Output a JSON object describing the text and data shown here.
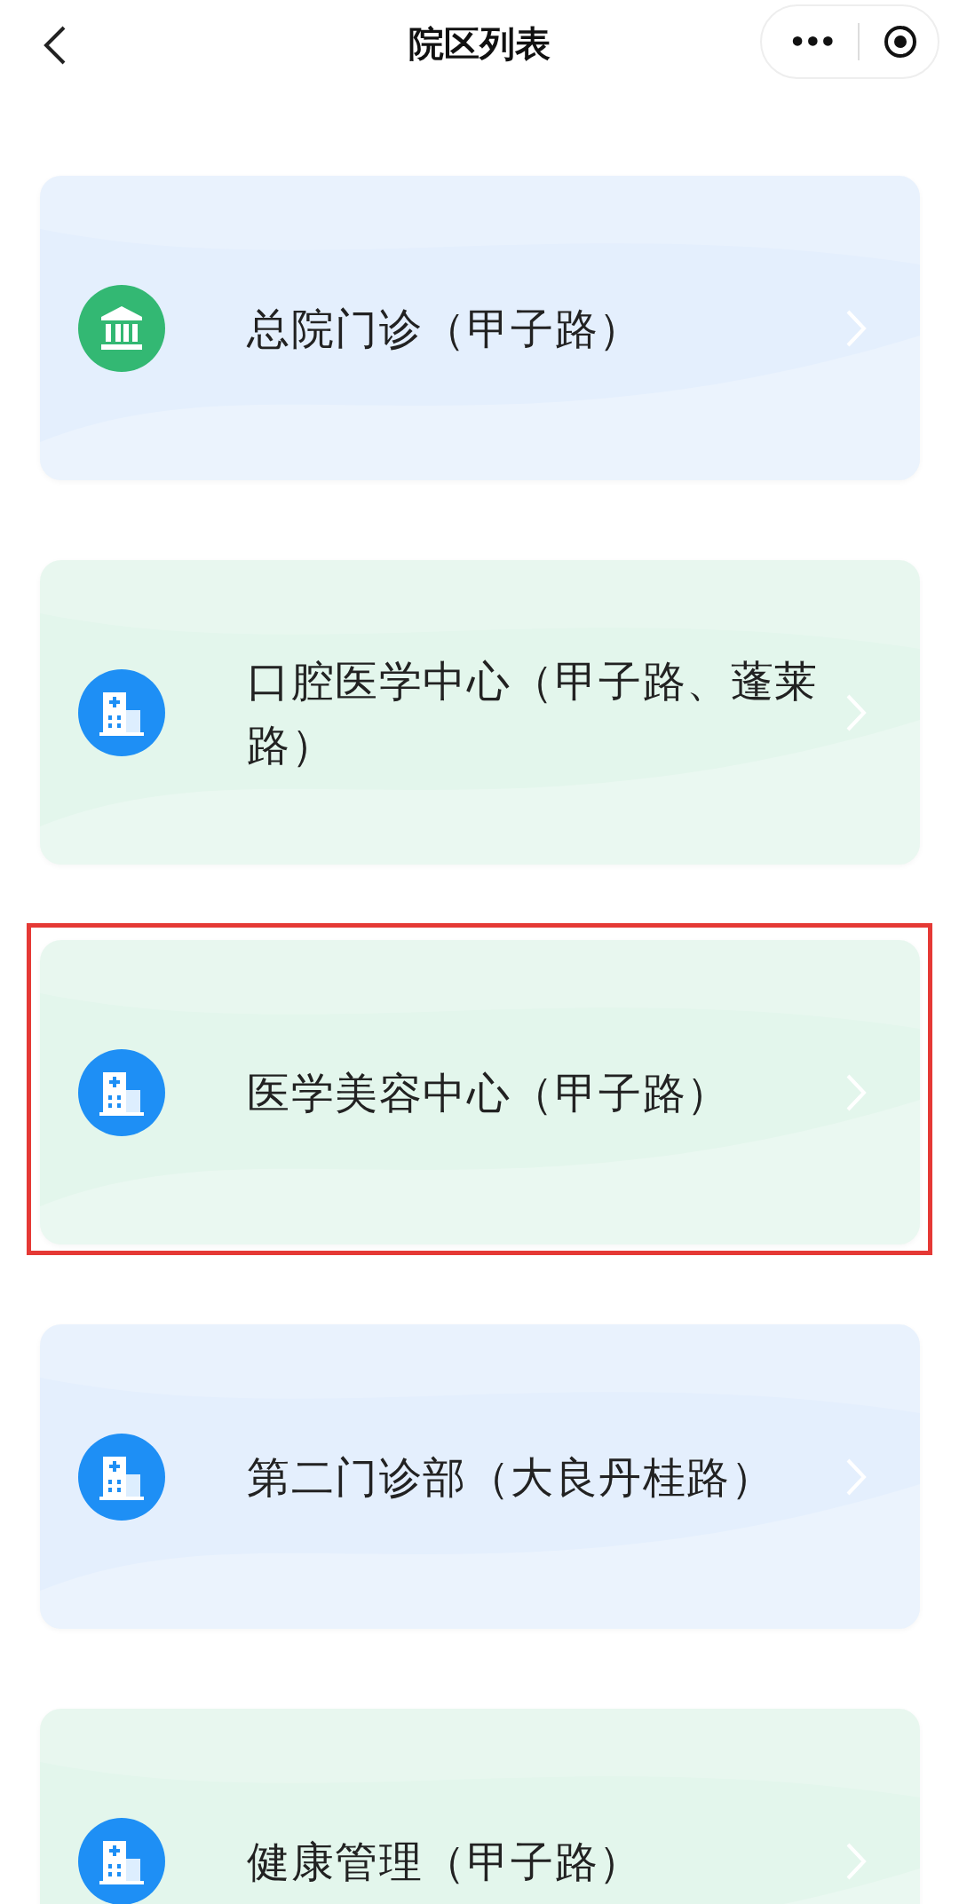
{
  "nav": {
    "title": "院区列表",
    "menu": "•••"
  },
  "campuses": [
    {
      "name": "总院门诊（甲子路）",
      "color": "#e4effd",
      "kind": "bank",
      "highlighted": false
    },
    {
      "name": "口腔医学中心（甲子路、蓬莱路）",
      "color": "#e3f6ec",
      "kind": "hospital",
      "highlighted": false
    },
    {
      "name": "医学美容中心（甲子路）",
      "color": "#e3f6ec",
      "kind": "hospital",
      "highlighted": true
    },
    {
      "name": "第二门诊部（大良丹桂路）",
      "color": "#e4effd",
      "kind": "hospital",
      "highlighted": false
    },
    {
      "name": "健康管理（甲子路）",
      "color": "#e3f6ec",
      "kind": "hospital",
      "highlighted": false
    }
  ]
}
